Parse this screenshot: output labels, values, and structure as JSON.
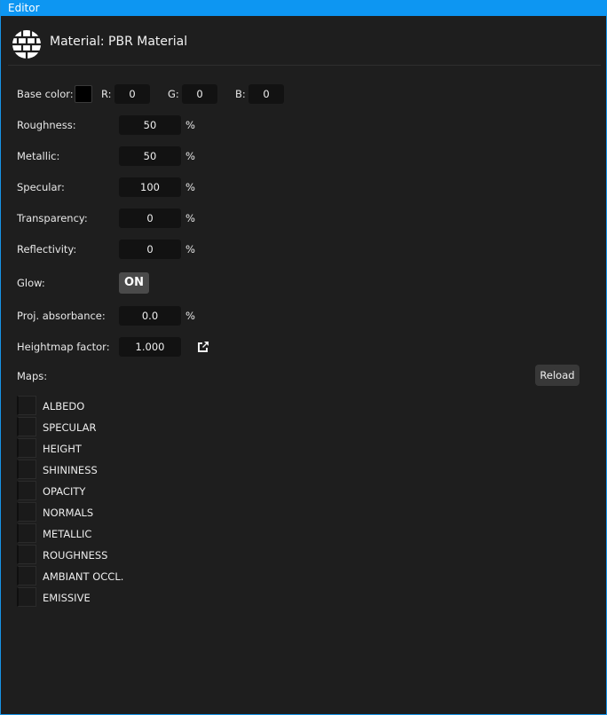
{
  "window": {
    "title": "Editor"
  },
  "header": {
    "title": "Material: PBR Material"
  },
  "base_color": {
    "label": "Base color:",
    "swatch_color": "#000000",
    "r_label": "R:",
    "r_value": "0",
    "g_label": "G:",
    "g_value": "0",
    "b_label": "B:",
    "b_value": "0"
  },
  "properties": {
    "roughness": {
      "label": "Roughness:",
      "value": "50",
      "unit": "%"
    },
    "metallic": {
      "label": "Metallic:",
      "value": "50",
      "unit": "%"
    },
    "specular": {
      "label": "Specular:",
      "value": "100",
      "unit": "%"
    },
    "transparency": {
      "label": "Transparency:",
      "value": "0",
      "unit": "%"
    },
    "reflectivity": {
      "label": "Reflectivity:",
      "value": "0",
      "unit": "%"
    },
    "glow": {
      "label": "Glow:",
      "value": "ON"
    },
    "proj_absorbance": {
      "label": "Proj. absorbance:",
      "value": "0.0",
      "unit": "%"
    },
    "heightmap_factor": {
      "label": "Heightmap factor:",
      "value": "1.000",
      "icon": "external-link-icon"
    }
  },
  "maps": {
    "label": "Maps:",
    "reload_label": "Reload",
    "items": [
      "ALBEDO",
      "SPECULAR",
      "HEIGHT",
      "SHININESS",
      "OPACITY",
      "NORMALS",
      "METALLIC",
      "ROUGHNESS",
      "AMBIANT OCCL.",
      "EMISSIVE"
    ]
  },
  "colors": {
    "accent": "#0d96f2",
    "background": "#1e1e1e",
    "field": "#121212"
  }
}
